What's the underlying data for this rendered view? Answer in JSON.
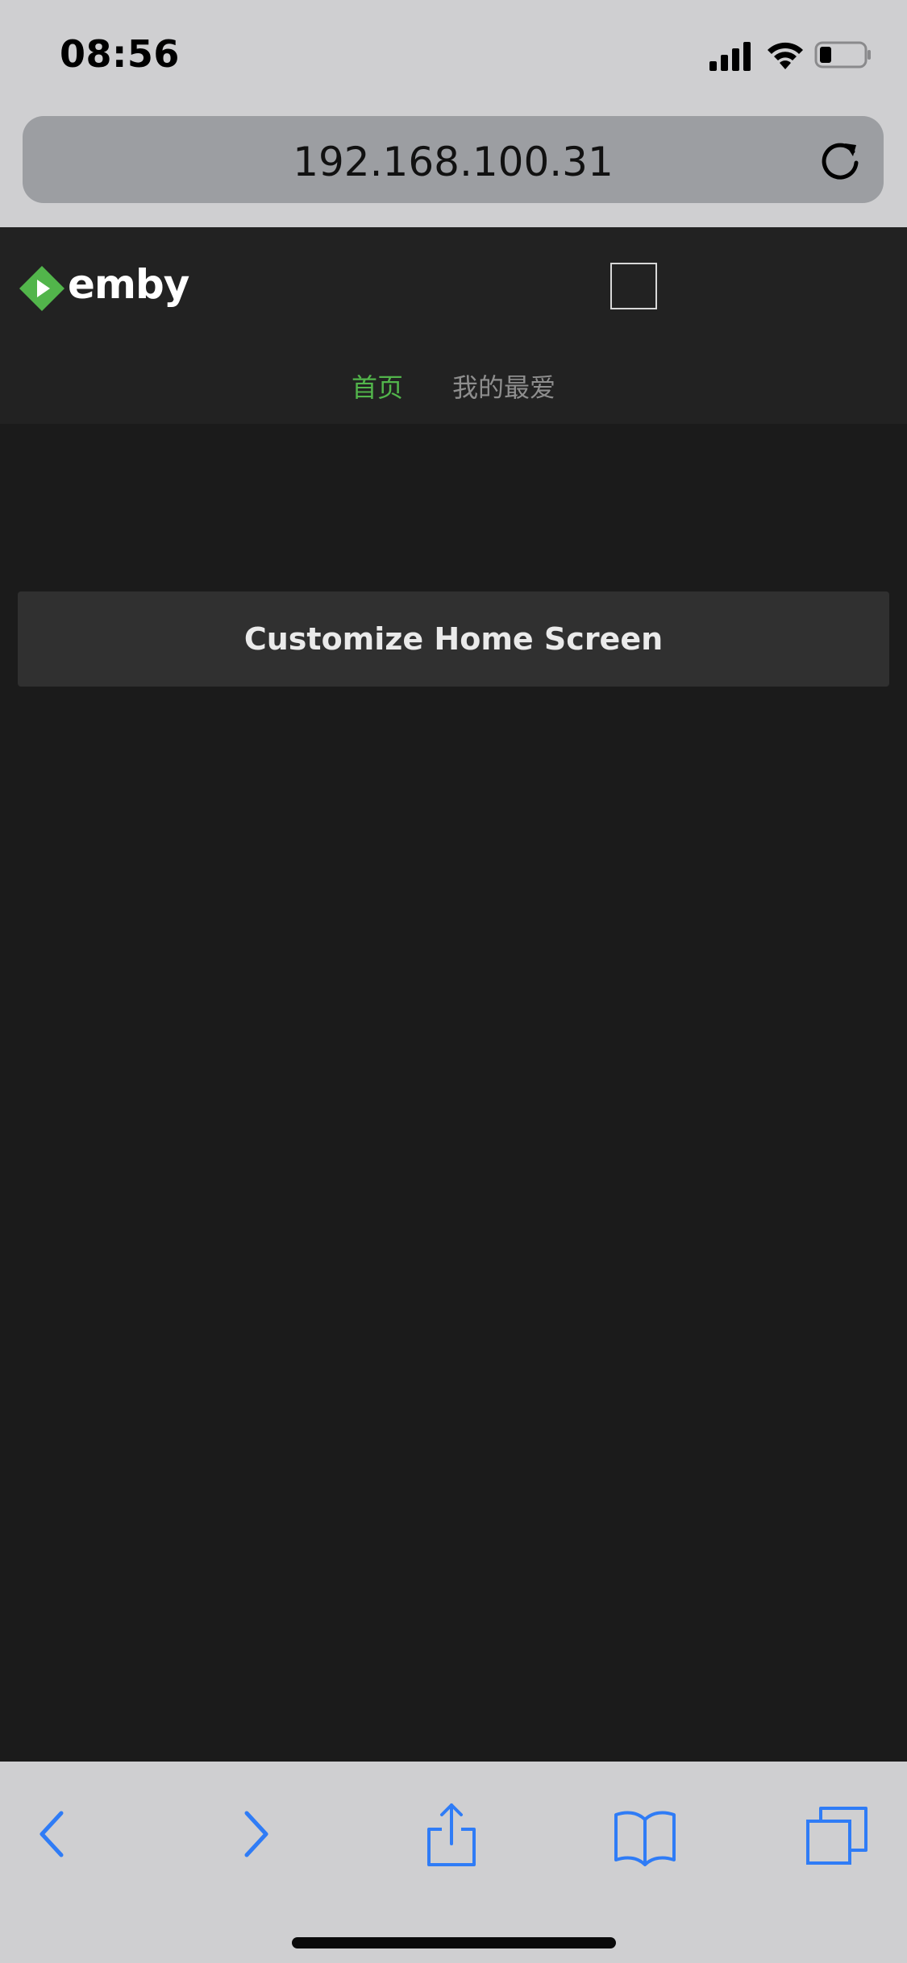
{
  "status_bar": {
    "time": "08:56",
    "icons": [
      "signal-icon",
      "wifi-icon",
      "battery-icon"
    ]
  },
  "browser": {
    "url": "192.168.100.31",
    "reload_icon": "reload-icon"
  },
  "app": {
    "logo_text": "emby",
    "logo_icon": "emby-logo-icon",
    "header_square_icon": "cast-icon",
    "tabs": [
      {
        "label": "首页",
        "active": true
      },
      {
        "label": "我的最爱",
        "active": false
      }
    ],
    "accent_color": "#52b54b"
  },
  "main": {
    "customize_button_label": "Customize Home Screen"
  },
  "toolbar": {
    "icons": [
      "back-icon",
      "forward-icon",
      "share-icon",
      "bookmarks-icon",
      "tabs-icon"
    ],
    "icon_color": "#2f7cf6"
  }
}
